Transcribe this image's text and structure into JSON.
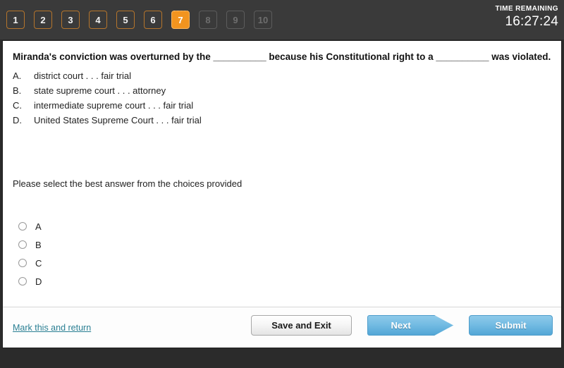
{
  "topbar": {
    "tabs": [
      {
        "label": "1",
        "state": "visited"
      },
      {
        "label": "2",
        "state": "visited"
      },
      {
        "label": "3",
        "state": "visited"
      },
      {
        "label": "4",
        "state": "visited"
      },
      {
        "label": "5",
        "state": "visited"
      },
      {
        "label": "6",
        "state": "visited"
      },
      {
        "label": "7",
        "state": "current"
      },
      {
        "label": "8",
        "state": "locked"
      },
      {
        "label": "9",
        "state": "locked"
      },
      {
        "label": "10",
        "state": "locked"
      }
    ],
    "timer": {
      "label": "TIME REMAINING",
      "value": "16:27:24"
    },
    "colors": {
      "background": "#3a3a3a",
      "current_tab": "#f2941f",
      "visited_border": "#b5752c",
      "locked_border": "#5c5c5c"
    }
  },
  "question": {
    "text": "Miranda's conviction was overturned by the __________ because his Constitutional right to a __________ was violated.",
    "choices": [
      {
        "letter": "A.",
        "text": "district court . . . fair trial"
      },
      {
        "letter": "B.",
        "text": "state supreme court . . . attorney"
      },
      {
        "letter": "C.",
        "text": "intermediate supreme court . . . fair trial"
      },
      {
        "letter": "D.",
        "text": "United States Supreme Court . . . fair trial"
      }
    ],
    "instruction": "Please select the best answer from the choices provided"
  },
  "answer_options": [
    {
      "label": "A",
      "selected": false
    },
    {
      "label": "B",
      "selected": false
    },
    {
      "label": "C",
      "selected": false
    },
    {
      "label": "D",
      "selected": false
    }
  ],
  "footer": {
    "mark_link": "Mark this and return",
    "save_label": "Save and Exit",
    "next_label": "Next",
    "submit_label": "Submit",
    "colors": {
      "link": "#2a7f93",
      "primary_button": "#74bce3"
    }
  }
}
